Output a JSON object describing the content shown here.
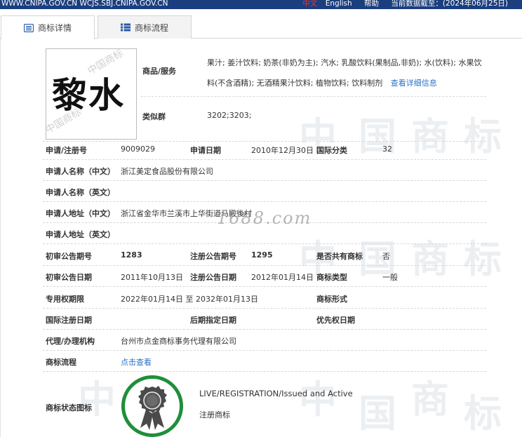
{
  "topbar": {
    "sites": "WWW.CNIPA.GOV.CN  WCJS.SBJ.CNIPA.GOV.CN",
    "lang_zh": "中文",
    "lang_en": "English",
    "help": "帮助",
    "data_cutoff": "当前数据截至：(2024年06月25日)"
  },
  "tabs": [
    {
      "label": "商标详情",
      "icon": "document-list-icon",
      "active": true
    },
    {
      "label": "商标流程",
      "icon": "list-icon",
      "active": false
    }
  ],
  "logo": {
    "text": "黎水",
    "stamp_text": "中国商标"
  },
  "watermark": {
    "chars": [
      "中",
      "国",
      "商",
      "标"
    ],
    "site": "1688.com"
  },
  "goods": {
    "label": "商品/服务",
    "value": "果汁; 姜汁饮料; 奶茶(非奶为主); 汽水; 乳酸饮料(果制品,非奶); 水(饮料); 水果饮料(不含酒精); 无酒精果汁饮料; 植物饮料; 饮料制剂",
    "more_link": "查看详细信息"
  },
  "similar_group": {
    "label": "类似群",
    "value": "3202;3203;"
  },
  "rows": {
    "reg_no_label": "申请/注册号",
    "reg_no": "9009029",
    "apply_date_label": "申请日期",
    "apply_date": "2010年12月30日",
    "intl_class_label": "国际分类",
    "intl_class": "32",
    "applicant_cn_label": "申请人名称（中文）",
    "applicant_cn": "浙江美定食品股份有限公司",
    "applicant_en_label": "申请人名称（英文）",
    "applicant_en": "",
    "address_cn_label": "申请人地址（中文）",
    "address_cn": "浙江省金华市兰溪市上华街道马殿後村",
    "address_en_label": "申请人地址（英文）",
    "address_en": "",
    "prelim_issue_label": "初审公告期号",
    "prelim_issue": "1283",
    "reg_issue_label": "注册公告期号",
    "reg_issue": "1295",
    "shared_label": "是否共有商标",
    "shared": "否",
    "prelim_date_label": "初审公告日期",
    "prelim_date": "2011年10月13日",
    "reg_date_label": "注册公告日期",
    "reg_date": "2012年01月14日",
    "mark_type_label": "商标类型",
    "mark_type": "一般",
    "exclusive_label": "专用权期限",
    "exclusive": "2022年01月14日 至 2032年01月13日",
    "mark_form_label": "商标形式",
    "mark_form": "",
    "intl_reg_date_label": "国际注册日期",
    "intl_reg_date": "",
    "later_designation_label": "后期指定日期",
    "later_designation": "",
    "priority_date_label": "优先权日期",
    "priority_date": "",
    "agent_label": "代理/办理机构",
    "agent": "台州市点金商标事务代理有限公司",
    "flow_label": "商标流程",
    "flow_link": "点击查看",
    "status_icon_label": "商标状态图标",
    "status_en": "LIVE/REGISTRATION/Issued and Active",
    "status_cn": "注册商标"
  },
  "colors": {
    "topbar_bg": "#1a3e7e",
    "link": "#2a72c8",
    "status_ring": "#1e8f3a",
    "medal": "#4a4a4a"
  },
  "status_badge_icon": "award-medal-icon"
}
